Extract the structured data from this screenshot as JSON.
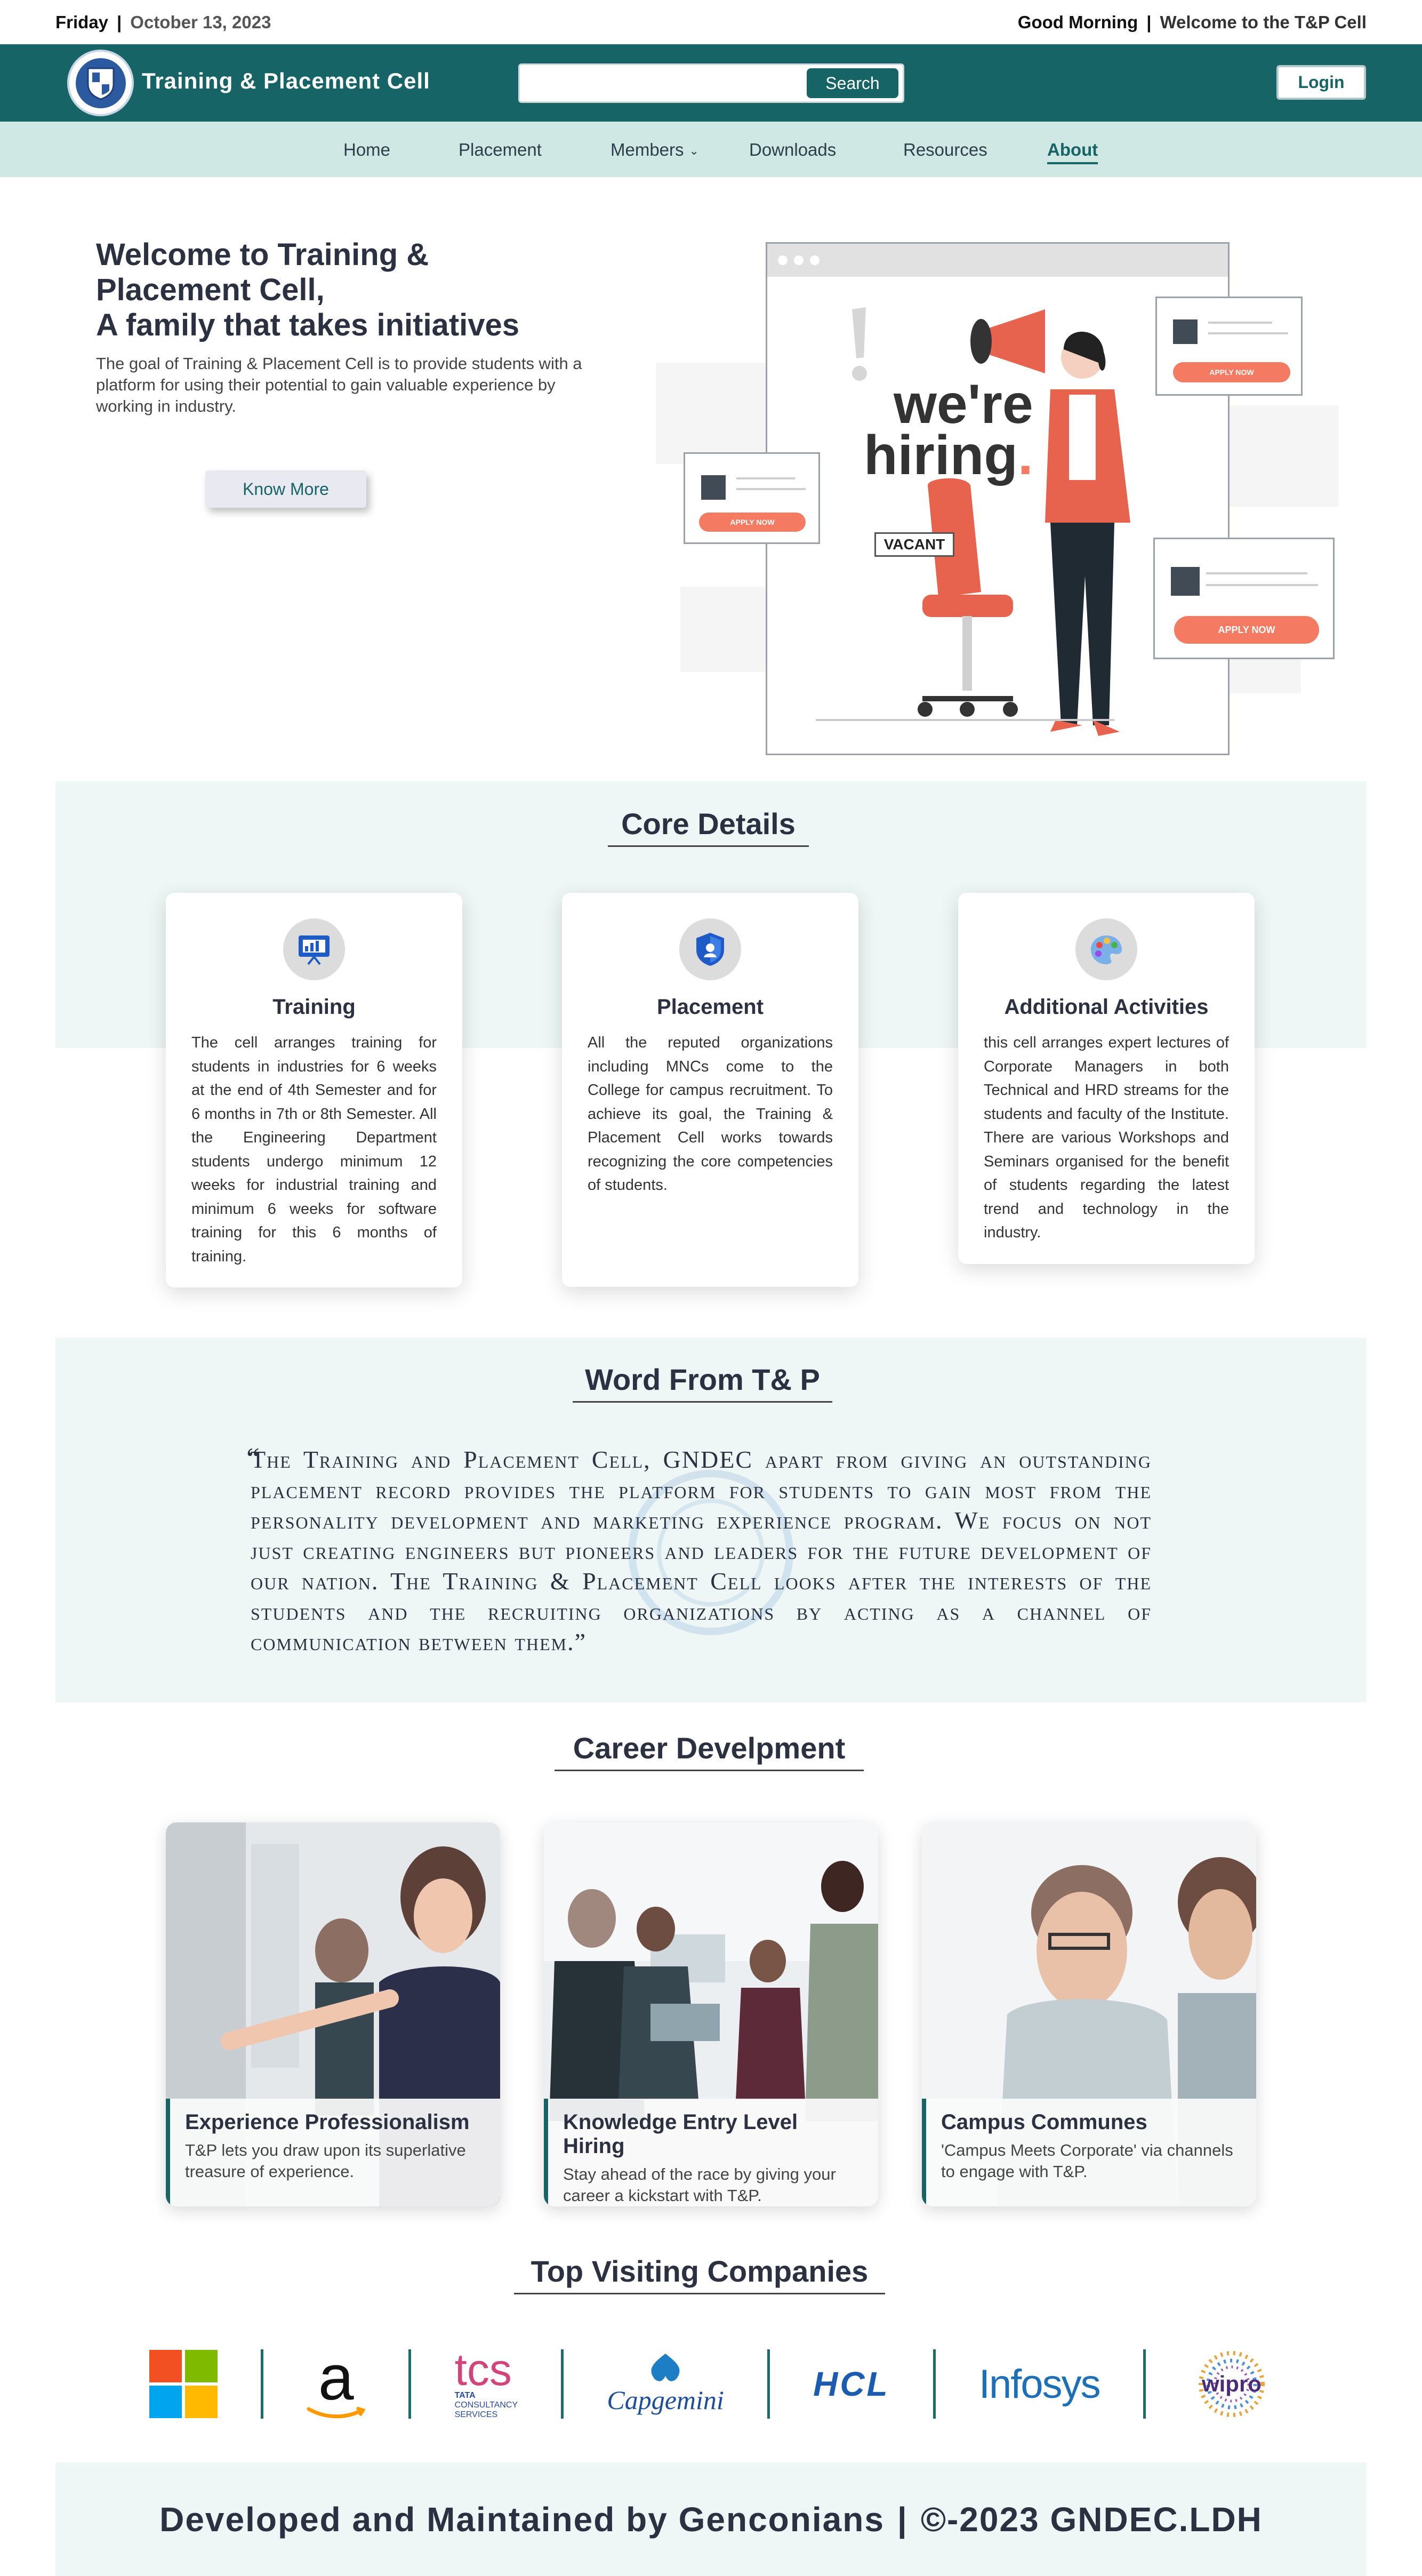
{
  "topbar": {
    "day": "Friday",
    "date": "October 13, 2023",
    "greeting": "Good Morning",
    "welcome": "Welcome to the T&P Cell"
  },
  "header": {
    "brand": "Training & Placement Cell",
    "search_placeholder": "",
    "search_label": "Search",
    "login_label": "Login",
    "primary_color": "#176466"
  },
  "nav": {
    "items": [
      {
        "label": "Home"
      },
      {
        "label": "Placement"
      },
      {
        "label": "Members"
      },
      {
        "label": "Downloads"
      },
      {
        "label": "Resources"
      },
      {
        "label": "About"
      }
    ],
    "active": "About"
  },
  "hero": {
    "title_line1": "Welcome to Training &",
    "title_line2": "Placement Cell,",
    "title_line3": "A family that takes initiatives",
    "description": "The goal of Training & Placement Cell is to provide students with a platform for using their potential to gain valuable experience by working in industry.",
    "button": "Know More",
    "illustration": {
      "headline_line1": "we're",
      "headline_line2": "hiring",
      "headline_dot": ".",
      "vacant": "VACANT",
      "apply": "APPLY NOW"
    }
  },
  "core": {
    "title": "Core Details",
    "cards": [
      {
        "icon": "presentation-board-icon",
        "title": "Training",
        "text": "The cell arranges training for students in industries for 6 weeks at the end of 4th Semester and for 6 months in 7th or 8th Semester. All the Engineering Department students undergo minimum 12 weeks for industrial training and minimum 6 weeks for software training for this 6 months of training."
      },
      {
        "icon": "shield-icon",
        "title": "Placement",
        "text": "All the reputed organizations including MNCs come to the College for campus recruitment. To achieve its goal, the Training & Placement Cell works towards recognizing the core competencies of students."
      },
      {
        "icon": "palette-icon",
        "title": "Additional Activities",
        "text": "this cell arranges expert lectures of Corporate Managers in both Technical and HRD streams for the students and faculty of the Institute. There are various Workshops and Seminars organised for the benefit of students regarding the latest trend and technology in the industry."
      }
    ]
  },
  "word": {
    "title": "Word From T& P",
    "open_quote": "“",
    "quote": "The Training and Placement Cell, GNDEC apart from giving an outstanding placement record provides the platform for students to gain most from the personality development and marketing experience program. We focus on not just creating engineers but pioneers and leaders for the future development of our nation. The Training & Placement Cell looks after the interests of the students and the recruiting organizations by acting as a channel of communication between them.”"
  },
  "career": {
    "title": "Career Develpment",
    "cards": [
      {
        "title": "Experience Professionalism",
        "text": "T&P lets you draw upon its superlative treasure of experience."
      },
      {
        "title": "Knowledge Entry Level Hiring",
        "text": "Stay ahead of the race by giving your career a kickstart with T&P."
      },
      {
        "title": "Campus Communes",
        "text": "'Campus Meets Corporate' via channels to engage with T&P."
      }
    ]
  },
  "companies": {
    "title": "Top Visiting Companies",
    "logos": {
      "tcs": "tcs",
      "tcs_sub1": "TATA",
      "tcs_sub2": "CONSULTANCY",
      "tcs_sub3": "SERVICES",
      "amazon": "a",
      "capgemini": "Capgemini",
      "hcl": "HCL",
      "infosys": "Infosys",
      "wipro": "wipro"
    }
  },
  "footer": {
    "text": "Developed and Maintained by Genconians",
    "separator": "|",
    "copyright_symbol": "©",
    "copyright": "-2023 GNDEC.LDH"
  }
}
